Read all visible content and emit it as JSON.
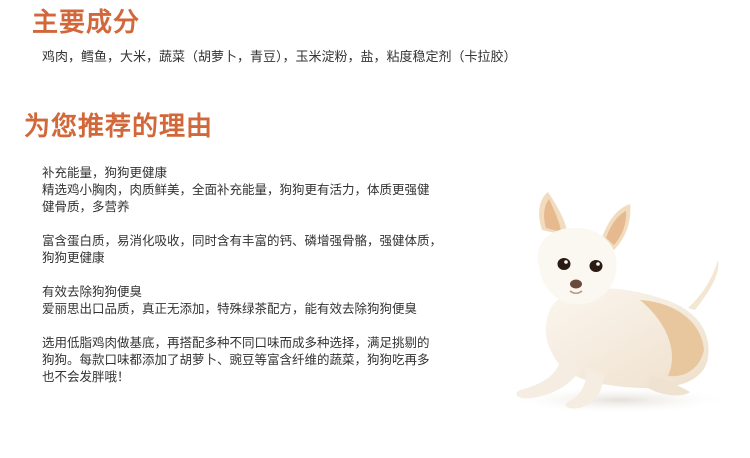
{
  "sections": {
    "ingredients_title": "主要成分",
    "ingredients_text": "鸡肉，鳕鱼，大米，蔬菜（胡萝卜，青豆），玉米淀粉，盐，粘度稳定剂（卡拉胶）",
    "reasons_title": "为您推荐的理由"
  },
  "reasons": [
    {
      "lines": [
        "补充能量，狗狗更健康",
        "精选鸡小胸肉，肉质鲜美，全面补充能量，狗狗更有活力，体质更强健",
        "健骨质，多营养"
      ]
    },
    {
      "lines": [
        "富含蛋白质，易消化吸收，同时含有丰富的钙、磷增强骨骼，强健体质，",
        "狗狗更健康"
      ]
    },
    {
      "lines": [
        "有效去除狗狗便臭",
        "爱丽思出口品质，真正无添加，特殊绿茶配方，能有效去除狗狗便臭"
      ]
    },
    {
      "lines": [
        "选用低脂鸡肉做基底，再搭配多种不同口味而成多种选择，满足挑剔的",
        "狗狗。每款口味都添加了胡萝卜、豌豆等富含纤维的蔬菜，狗狗吃再多",
        "也不会发胖哦！"
      ]
    }
  ],
  "colors": {
    "heading": "#d2683a",
    "body_text": "#333333"
  }
}
